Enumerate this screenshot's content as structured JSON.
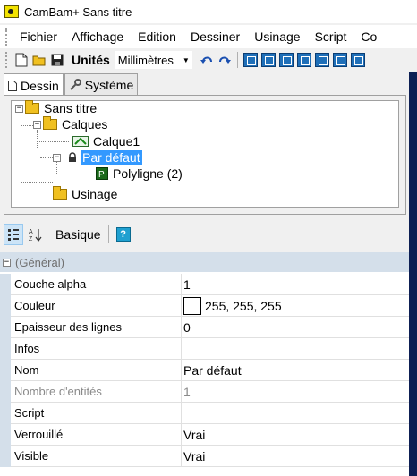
{
  "window": {
    "title": "CamBam+  Sans titre"
  },
  "menu": [
    "Fichier",
    "Affichage",
    "Edition",
    "Dessiner",
    "Usinage",
    "Script",
    "Co"
  ],
  "toolbar": {
    "units_label": "Unités",
    "units_value": "Millimètres",
    "icons": [
      "new-file-icon",
      "open-folder-icon",
      "save-icon",
      "undo-icon",
      "redo-icon"
    ],
    "view_buttons": [
      "view-button-1",
      "view-button-2",
      "view-button-3",
      "view-button-4",
      "view-button-5",
      "view-button-6",
      "view-button-7"
    ]
  },
  "tabs": [
    {
      "label": "Dessin",
      "icon": "document-icon",
      "active": true
    },
    {
      "label": "Système",
      "icon": "wrench-icon",
      "active": false
    }
  ],
  "tree": {
    "root": "Sans titre",
    "layers": "Calques",
    "layer1": "Calque1",
    "default_layer": "Par défaut",
    "polyline": "Polyligne (2)",
    "machining": "Usinage"
  },
  "property_toolbar": {
    "basic_label": "Basique",
    "help_label": "?"
  },
  "properties": {
    "category": "(Général)",
    "rows": [
      {
        "name": "Couche alpha",
        "value": "1"
      },
      {
        "name": "Couleur",
        "value": "255, 255, 255"
      },
      {
        "name": "Epaisseur des lignes",
        "value": "0"
      },
      {
        "name": "Infos",
        "value": ""
      },
      {
        "name": "Nom",
        "value": "Par défaut"
      },
      {
        "name": "Nombre d'entités",
        "value": "1"
      },
      {
        "name": "Script",
        "value": ""
      },
      {
        "name": "Verrouillé",
        "value": "Vrai"
      },
      {
        "name": "Visible",
        "value": "Vrai"
      }
    ],
    "swatch_color": "#ffffff"
  },
  "colors": {
    "selection": "#3399ff",
    "category_bg": "#d4dfea",
    "accent_dark": "#0d1f54"
  }
}
